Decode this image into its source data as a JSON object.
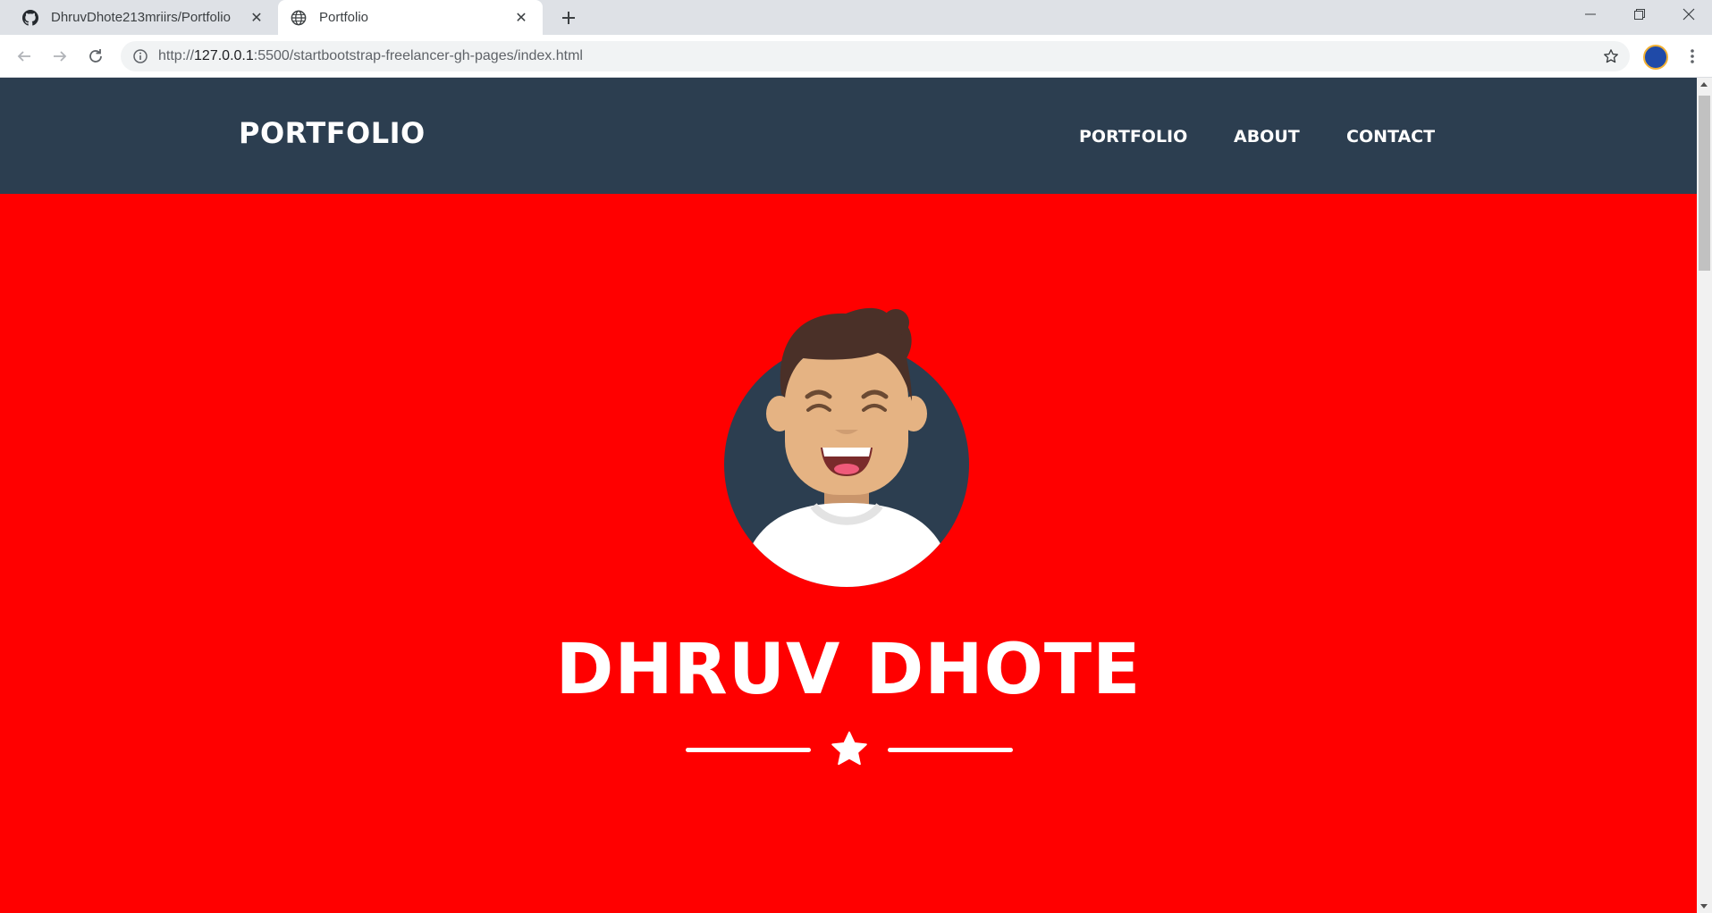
{
  "browser": {
    "tabs": [
      {
        "title": "DhruvDhote213mriirs/Portfolio",
        "icon": "github-icon",
        "active": false
      },
      {
        "title": "Portfolio",
        "icon": "globe-icon",
        "active": true
      }
    ],
    "url_host": "127.0.0.1",
    "url_full_prefix": "http://",
    "url_rest": ":5500/startbootstrap-freelancer-gh-pages/index.html"
  },
  "site": {
    "brand": "PORTFOLIO",
    "nav": [
      {
        "label": "PORTFOLIO"
      },
      {
        "label": "ABOUT"
      },
      {
        "label": "CONTACT"
      }
    ],
    "masthead_title": "DHRUV DHOTE",
    "divider_icon": "star-icon",
    "avatar_icon": "avatar-illustration"
  },
  "colors": {
    "navbar": "#2c3e50",
    "masthead": "#ff0000",
    "text": "#ffffff"
  }
}
